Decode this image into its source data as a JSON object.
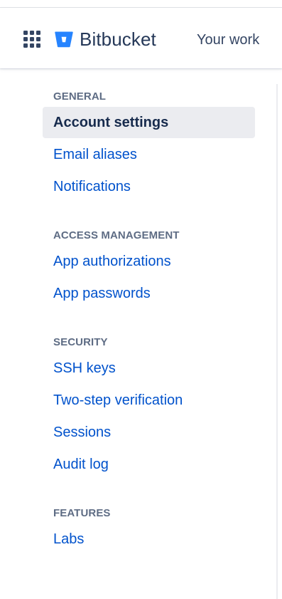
{
  "header": {
    "app_switcher_icon": "grid-icon",
    "logo_icon": "bitbucket-logo-icon",
    "logo_text": "Bitbucket",
    "your_work": "Your work"
  },
  "colors": {
    "brand": "#2684ff",
    "link": "#0052cc",
    "heading": "#5e6c84",
    "active_bg": "#ebecf0",
    "text": "#172b4d"
  },
  "nav": {
    "general": {
      "heading": "GENERAL",
      "items": [
        {
          "label": "Account settings",
          "active": true
        },
        {
          "label": "Email aliases"
        },
        {
          "label": "Notifications"
        }
      ]
    },
    "access": {
      "heading": "ACCESS MANAGEMENT",
      "items": [
        {
          "label": "App authorizations"
        },
        {
          "label": "App passwords"
        }
      ]
    },
    "security": {
      "heading": "SECURITY",
      "items": [
        {
          "label": "SSH keys"
        },
        {
          "label": "Two-step verification"
        },
        {
          "label": "Sessions"
        },
        {
          "label": "Audit log"
        }
      ]
    },
    "features": {
      "heading": "FEATURES",
      "items": [
        {
          "label": "Labs"
        }
      ]
    }
  }
}
